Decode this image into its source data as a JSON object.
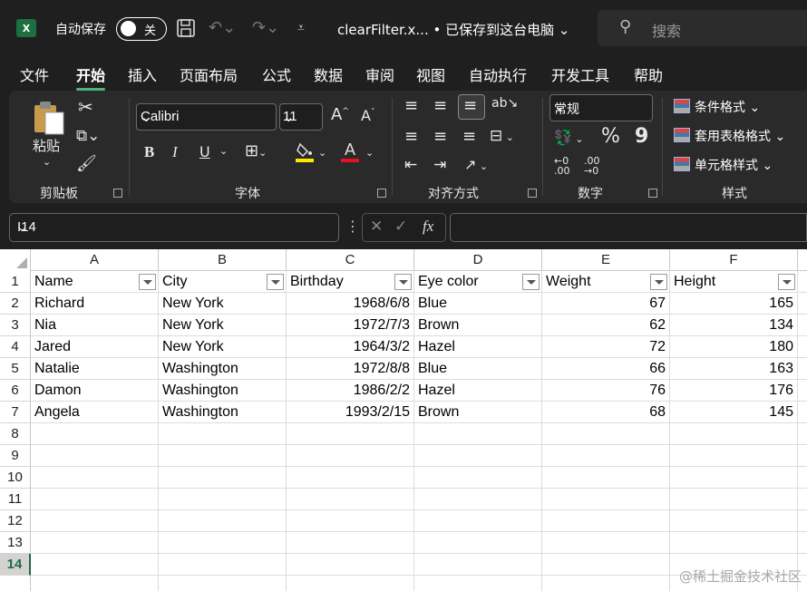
{
  "titlebar": {
    "app_logo": "X",
    "autosave_label": "自动保存",
    "autosave_state": "关",
    "filename": "clearFilter.x... • 已保存到这台电脑 ⌄",
    "search_placeholder": "搜索"
  },
  "menu": {
    "tabs": [
      "文件",
      "开始",
      "插入",
      "页面布局",
      "公式",
      "数据",
      "审阅",
      "视图",
      "自动执行",
      "开发工具",
      "帮助"
    ],
    "active": "开始"
  },
  "ribbon": {
    "clipboard": {
      "paste_label": "粘贴",
      "group_label": "剪贴板"
    },
    "font": {
      "name": "Calibri",
      "size": "11",
      "group_label": "字体",
      "bold": "B",
      "italic": "I",
      "underline": "U"
    },
    "alignment": {
      "group_label": "对齐方式"
    },
    "number": {
      "format": "常规",
      "group_label": "数字",
      "percent": "%",
      "comma": "9"
    },
    "styles": {
      "conditional": "条件格式",
      "table": "套用表格格式",
      "cell": "单元格样式",
      "group_label": "样式"
    }
  },
  "formula_bar": {
    "name_box": "I14",
    "fx": "fx",
    "value": ""
  },
  "sheet": {
    "columns": [
      "A",
      "B",
      "C",
      "D",
      "E",
      "F"
    ],
    "rows": [
      "1",
      "2",
      "3",
      "4",
      "5",
      "6",
      "7",
      "8",
      "9",
      "10",
      "11",
      "12",
      "13",
      "14"
    ],
    "selected_row": "14",
    "headers": [
      "Name",
      "City",
      "Birthday",
      "Eye color",
      "Weight",
      "Height"
    ],
    "data": [
      [
        "Richard",
        "New York",
        "1968/6/8",
        "Blue",
        "67",
        "165"
      ],
      [
        "Nia",
        "New York",
        "1972/7/3",
        "Brown",
        "62",
        "134"
      ],
      [
        "Jared",
        "New York",
        "1964/3/2",
        "Hazel",
        "72",
        "180"
      ],
      [
        "Natalie",
        "Washington",
        "1972/8/8",
        "Blue",
        "66",
        "163"
      ],
      [
        "Damon",
        "Washington",
        "1986/2/2",
        "Hazel",
        "76",
        "176"
      ],
      [
        "Angela",
        "Washington",
        "1993/2/15",
        "Brown",
        "68",
        "145"
      ]
    ]
  },
  "watermark": "@稀土掘金技术社区",
  "colors": {
    "accent": "#4fb27b",
    "excel_green": "#1d6f42",
    "background": "#1f1f1f",
    "ribbon": "#2a2a2a"
  }
}
